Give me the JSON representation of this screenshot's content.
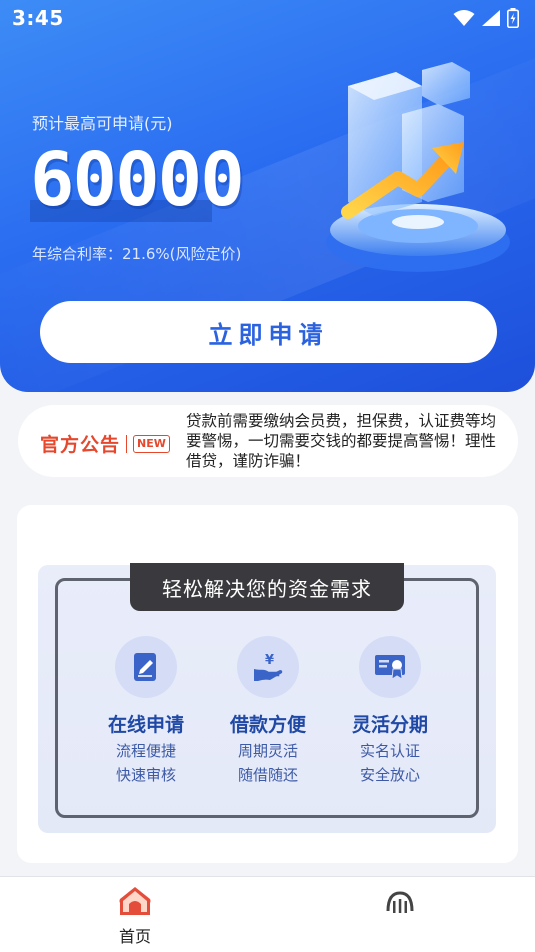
{
  "status_bar": {
    "time": "3:45"
  },
  "hero": {
    "label": "预计最高可申请(元)",
    "amount": "60000",
    "rate": "年综合利率：21.6%(风险定价)",
    "apply_button": "立即申请"
  },
  "notice": {
    "logo_text": "官方公告",
    "badge": "NEW",
    "text": "贷款前需要缴纳会员费，担保费，认证费等均要警惕，一切需要交钱的都要提高警惕！理性借贷，谨防诈骗！"
  },
  "features": {
    "title": "轻松解决您的资金需求",
    "items": [
      {
        "title": "在线申请",
        "line1": "流程便捷",
        "line2": "快速审核",
        "icon": "document-edit-icon"
      },
      {
        "title": "借款方便",
        "line1": "周期灵活",
        "line2": "随借随还",
        "icon": "yen-hand-icon"
      },
      {
        "title": "灵活分期",
        "line1": "实名认证",
        "line2": "安全放心",
        "icon": "certificate-icon"
      }
    ]
  },
  "bottom_nav": {
    "items": [
      {
        "label": "首页",
        "icon": "home-icon",
        "active": true
      },
      {
        "label": "",
        "icon": "profile-icon",
        "active": false
      }
    ]
  },
  "colors": {
    "hero_gradient_start": "#3d8cf6",
    "hero_gradient_end": "#1d4fdb",
    "primary_text": "#2a62e0",
    "notice_red": "#e5482d",
    "feature_blue": "#2049a6",
    "nav_active": "#e34d3a"
  }
}
